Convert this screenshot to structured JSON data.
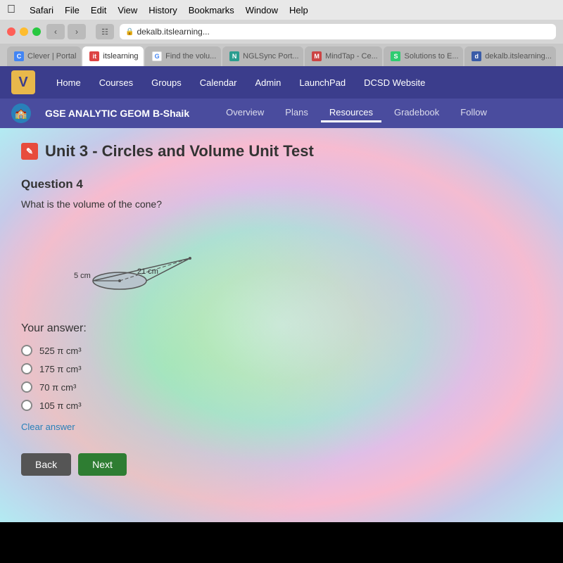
{
  "mac_menu": {
    "items": [
      "Safari",
      "File",
      "Edit",
      "View",
      "History",
      "Bookmarks",
      "Window",
      "Help"
    ]
  },
  "browser": {
    "tabs": [
      {
        "id": "clever",
        "label": "Clever | Portal",
        "favicon_type": "clever",
        "active": false
      },
      {
        "id": "itslearning",
        "label": "itslearning",
        "favicon_type": "its",
        "active": true
      },
      {
        "id": "findvolu",
        "label": "Find the volu...",
        "favicon_type": "google",
        "active": false
      },
      {
        "id": "nglsync",
        "label": "NGLSync Port...",
        "favicon_type": "ngl",
        "active": false
      },
      {
        "id": "mindtap",
        "label": "MindTap - Ce...",
        "favicon_type": "mind",
        "active": false
      },
      {
        "id": "solutions",
        "label": "Solutions to E...",
        "favicon_type": "solutions",
        "active": false
      },
      {
        "id": "dekalb",
        "label": "dekalb.itslearning...",
        "favicon_type": "dekalb",
        "active": false
      }
    ],
    "address": "dekalb.itslearning..."
  },
  "lms_nav": {
    "logo": "V",
    "items": [
      "Home",
      "Courses",
      "Groups",
      "Calendar",
      "Admin",
      "LaunchPad",
      "DCSD Website"
    ]
  },
  "course_header": {
    "title": "GSE ANALYTIC GEOM B-Shaik",
    "tabs": [
      "Overview",
      "Plans",
      "Resources",
      "Gradebook",
      "Follow"
    ]
  },
  "page": {
    "title": "Unit 3 - Circles and Volume Unit Test",
    "question_number": "Question 4",
    "question_text": "What is the volume of the cone?",
    "cone": {
      "radius_label": "5 cm",
      "slant_label": "21 cm"
    },
    "your_answer_label": "Your answer:",
    "options": [
      {
        "id": "opt1",
        "label": "525 π cm³"
      },
      {
        "id": "opt2",
        "label": "175 π cm³"
      },
      {
        "id": "opt3",
        "label": "70 π cm³"
      },
      {
        "id": "opt4",
        "label": "105 π cm³"
      }
    ],
    "clear_answer": "Clear answer",
    "back_button": "Back",
    "next_button": "Next"
  }
}
